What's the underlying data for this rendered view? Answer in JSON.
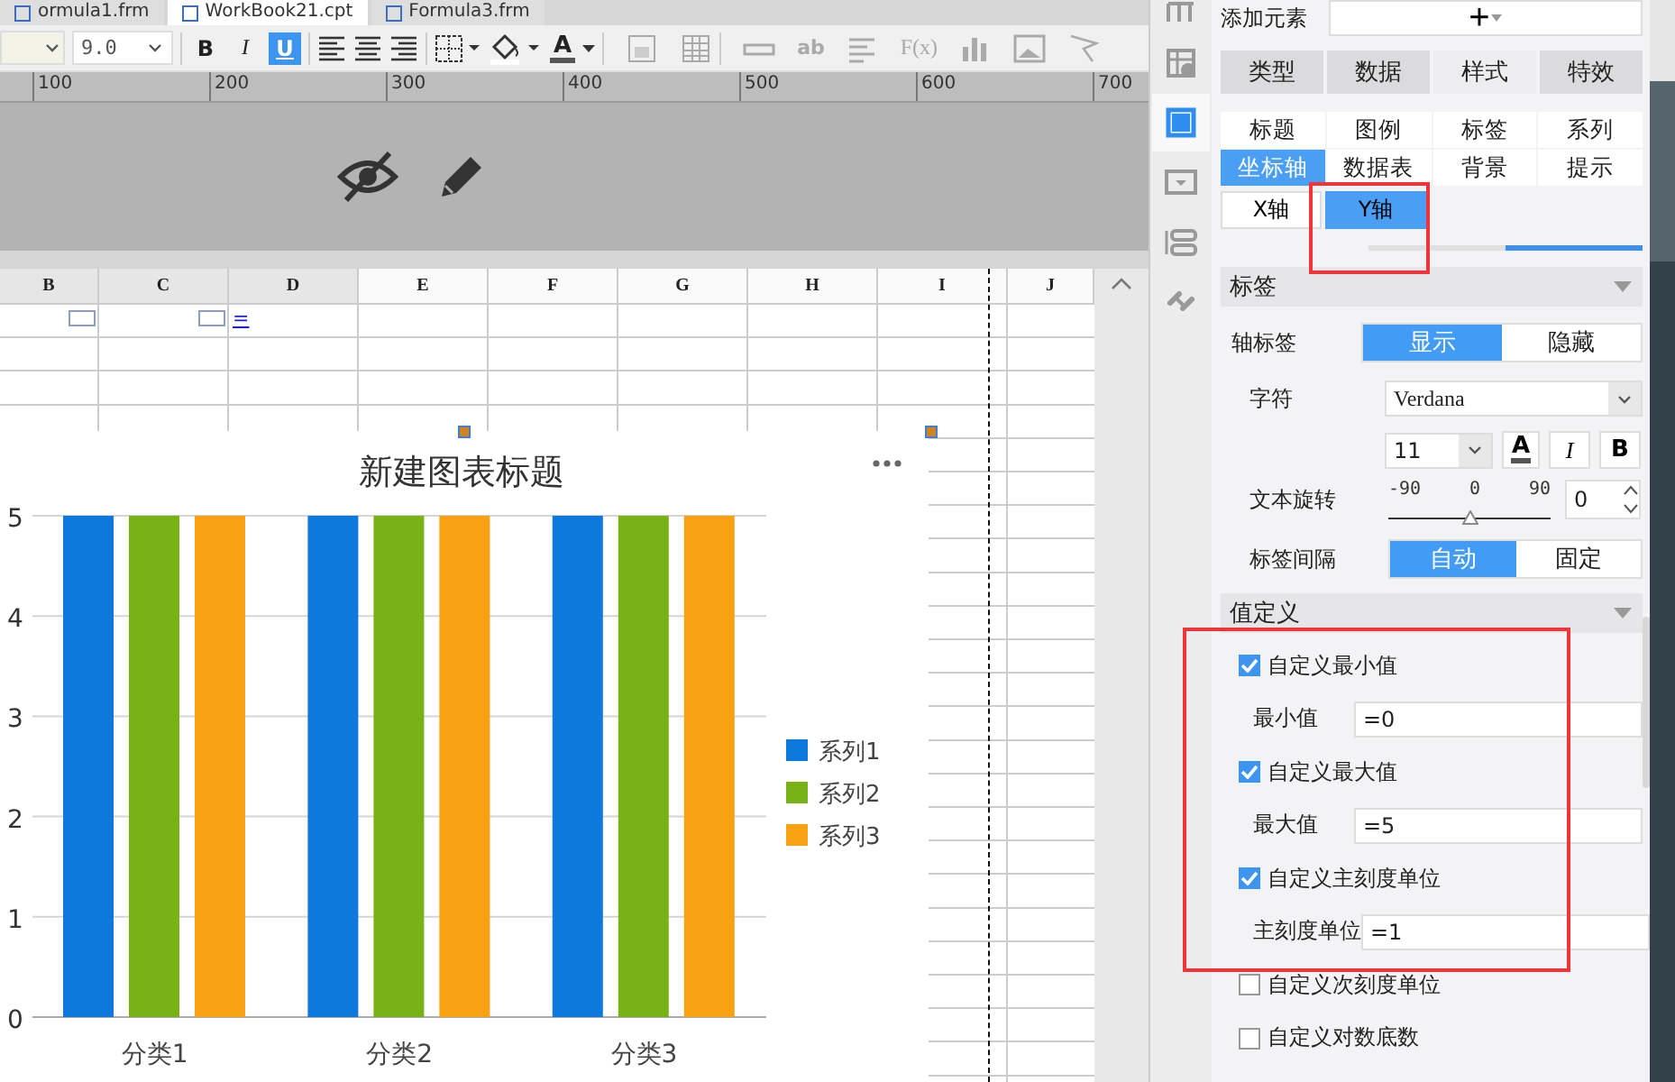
{
  "file_tabs": [
    {
      "label": "ormula1.frm",
      "selected": false
    },
    {
      "label": "WorkBook21.cpt",
      "selected": true
    },
    {
      "label": "Formula3.frm",
      "selected": false
    }
  ],
  "toolbar": {
    "font_size": "9.0",
    "format_buttons": [
      {
        "kind": "bold",
        "label": "B",
        "pressed": false
      },
      {
        "kind": "italic",
        "label": "I",
        "pressed": false
      },
      {
        "kind": "underline",
        "label": "U",
        "pressed": true
      }
    ],
    "font_color_label": "A",
    "text_icon_label": "ab",
    "formula_icon_label": "F(x)"
  },
  "ruler": {
    "marks": [
      "100",
      "200",
      "300",
      "400",
      "500",
      "600",
      "700"
    ]
  },
  "sheet": {
    "columns": [
      "B",
      "C",
      "D",
      "E",
      "F",
      "G",
      "H",
      "I",
      "J"
    ],
    "formula_cell": "="
  },
  "chart": {
    "chart_data": {
      "type": "bar",
      "title": "新建图表标题",
      "categories": [
        "分类1",
        "分类2",
        "分类3"
      ],
      "series": [
        {
          "name": "系列1",
          "color": "#0f78dc",
          "values": [
            5,
            5,
            5
          ]
        },
        {
          "name": "系列2",
          "color": "#78b214",
          "values": [
            5,
            5,
            5
          ]
        },
        {
          "name": "系列3",
          "color": "#f9a013",
          "values": [
            5,
            5,
            5
          ]
        }
      ],
      "ylim": [
        0,
        5
      ],
      "yticks": [
        0,
        1,
        2,
        3,
        4,
        5
      ],
      "grid": true,
      "legend": true
    }
  },
  "side_icons": [
    {
      "selected": false
    },
    {
      "selected": false
    },
    {
      "selected": true
    },
    {
      "selected": false
    },
    {
      "selected": false
    },
    {
      "selected": false
    }
  ],
  "panel": {
    "add_element": {
      "label": "添加元素",
      "button": "+"
    },
    "main_tabs": [
      {
        "label": "类型",
        "selected": false
      },
      {
        "label": "数据",
        "selected": false
      },
      {
        "label": "样式",
        "selected": true
      },
      {
        "label": "特效",
        "selected": false
      }
    ],
    "sub_tabs": [
      {
        "label": "标题",
        "selected": false
      },
      {
        "label": "图例",
        "selected": false
      },
      {
        "label": "标签",
        "selected": false
      },
      {
        "label": "系列",
        "selected": false
      },
      {
        "label": "坐标轴",
        "selected": true
      },
      {
        "label": "数据表",
        "selected": false
      },
      {
        "label": "背景",
        "selected": false
      },
      {
        "label": "提示",
        "selected": false
      }
    ],
    "axis_tabs": [
      {
        "label": "X轴",
        "selected": false
      },
      {
        "label": "Y轴",
        "selected": true
      }
    ],
    "label_section": {
      "title": "标签",
      "axis_label": {
        "label": "轴标签",
        "options": [
          {
            "label": "显示",
            "selected": true
          },
          {
            "label": "隐藏",
            "selected": false
          }
        ]
      },
      "font": {
        "label": "字符",
        "value": "Verdana",
        "size": "11",
        "color_button": "A",
        "italic_button": "I",
        "bold_button": "B"
      },
      "rotation": {
        "label": "文本旋转",
        "ticks": [
          "-90",
          "0",
          "90"
        ],
        "level": 0.5,
        "value": "0"
      },
      "interval": {
        "label": "标签间隔",
        "options": [
          {
            "label": "自动",
            "selected": true
          },
          {
            "label": "固定",
            "selected": false
          }
        ]
      }
    },
    "value_section": {
      "title": "值定义",
      "rows": [
        {
          "kind": "checkbox",
          "label": "自定义最小值",
          "checked": true
        },
        {
          "kind": "field",
          "label": "最小值",
          "value": "=0"
        },
        {
          "kind": "checkbox",
          "label": "自定义最大值",
          "checked": true
        },
        {
          "kind": "field",
          "label": "最大值",
          "value": "=5"
        },
        {
          "kind": "checkbox",
          "label": "自定义主刻度单位",
          "checked": true
        },
        {
          "kind": "field",
          "label": "主刻度单位",
          "value": "=1"
        },
        {
          "kind": "checkbox",
          "label": "自定义次刻度单位",
          "checked": false
        },
        {
          "kind": "checkbox",
          "label": "自定义对数底数",
          "checked": false
        }
      ]
    }
  }
}
